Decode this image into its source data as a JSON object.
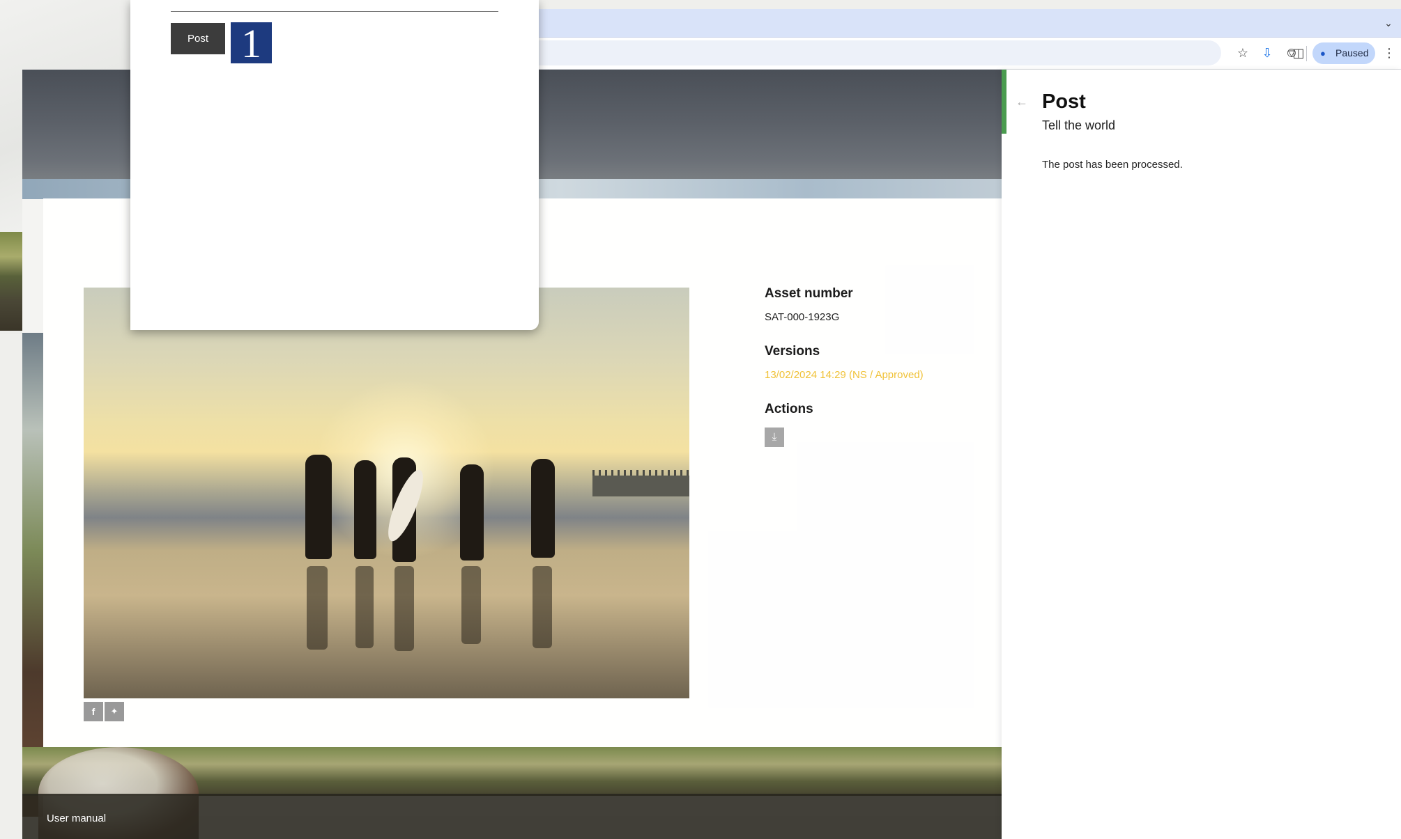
{
  "browser": {
    "profile_chip_label": "Paused",
    "icons": [
      "star-icon",
      "download-icon",
      "extensions-icon",
      "side-panel-icon",
      "profile-icon",
      "more-icon"
    ]
  },
  "popup": {
    "post_button_label": "Post",
    "counter_value": "1"
  },
  "asset": {
    "asset_number_label": "Asset number",
    "asset_number_value": "SAT-000-1923G",
    "versions_label": "Versions",
    "version_entry": "13/02/2024 14:29 (NS / Approved)",
    "actions_label": "Actions",
    "share_icons": [
      "facebook-icon",
      "twitter-icon"
    ]
  },
  "footer": {
    "user_manual_label": "User manual"
  },
  "panel": {
    "title": "Post",
    "subtitle": "Tell the world",
    "message": "The post has been processed."
  },
  "colors": {
    "version_link": "#f0c238",
    "panel_accent": "#4a9b4f",
    "popup_counter": "#1d3a7f",
    "chip_background": "#c2d7fb"
  }
}
